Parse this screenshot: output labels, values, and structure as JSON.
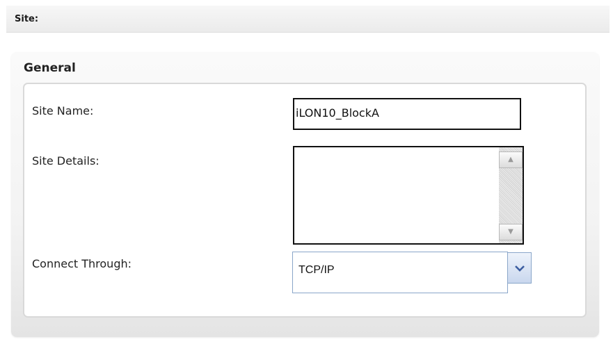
{
  "header": {
    "title": "Site:"
  },
  "general": {
    "title": "General",
    "site_name": {
      "label": "Site Name:",
      "value": "iLON10_BlockA"
    },
    "site_details": {
      "label": "Site Details:",
      "value": ""
    },
    "connect_through": {
      "label": "Connect Through:",
      "value": "TCP/IP"
    }
  },
  "icons": {
    "scroll_up": "arrow-up-icon",
    "scroll_down": "arrow-down-icon",
    "dropdown": "chevron-down-icon"
  }
}
